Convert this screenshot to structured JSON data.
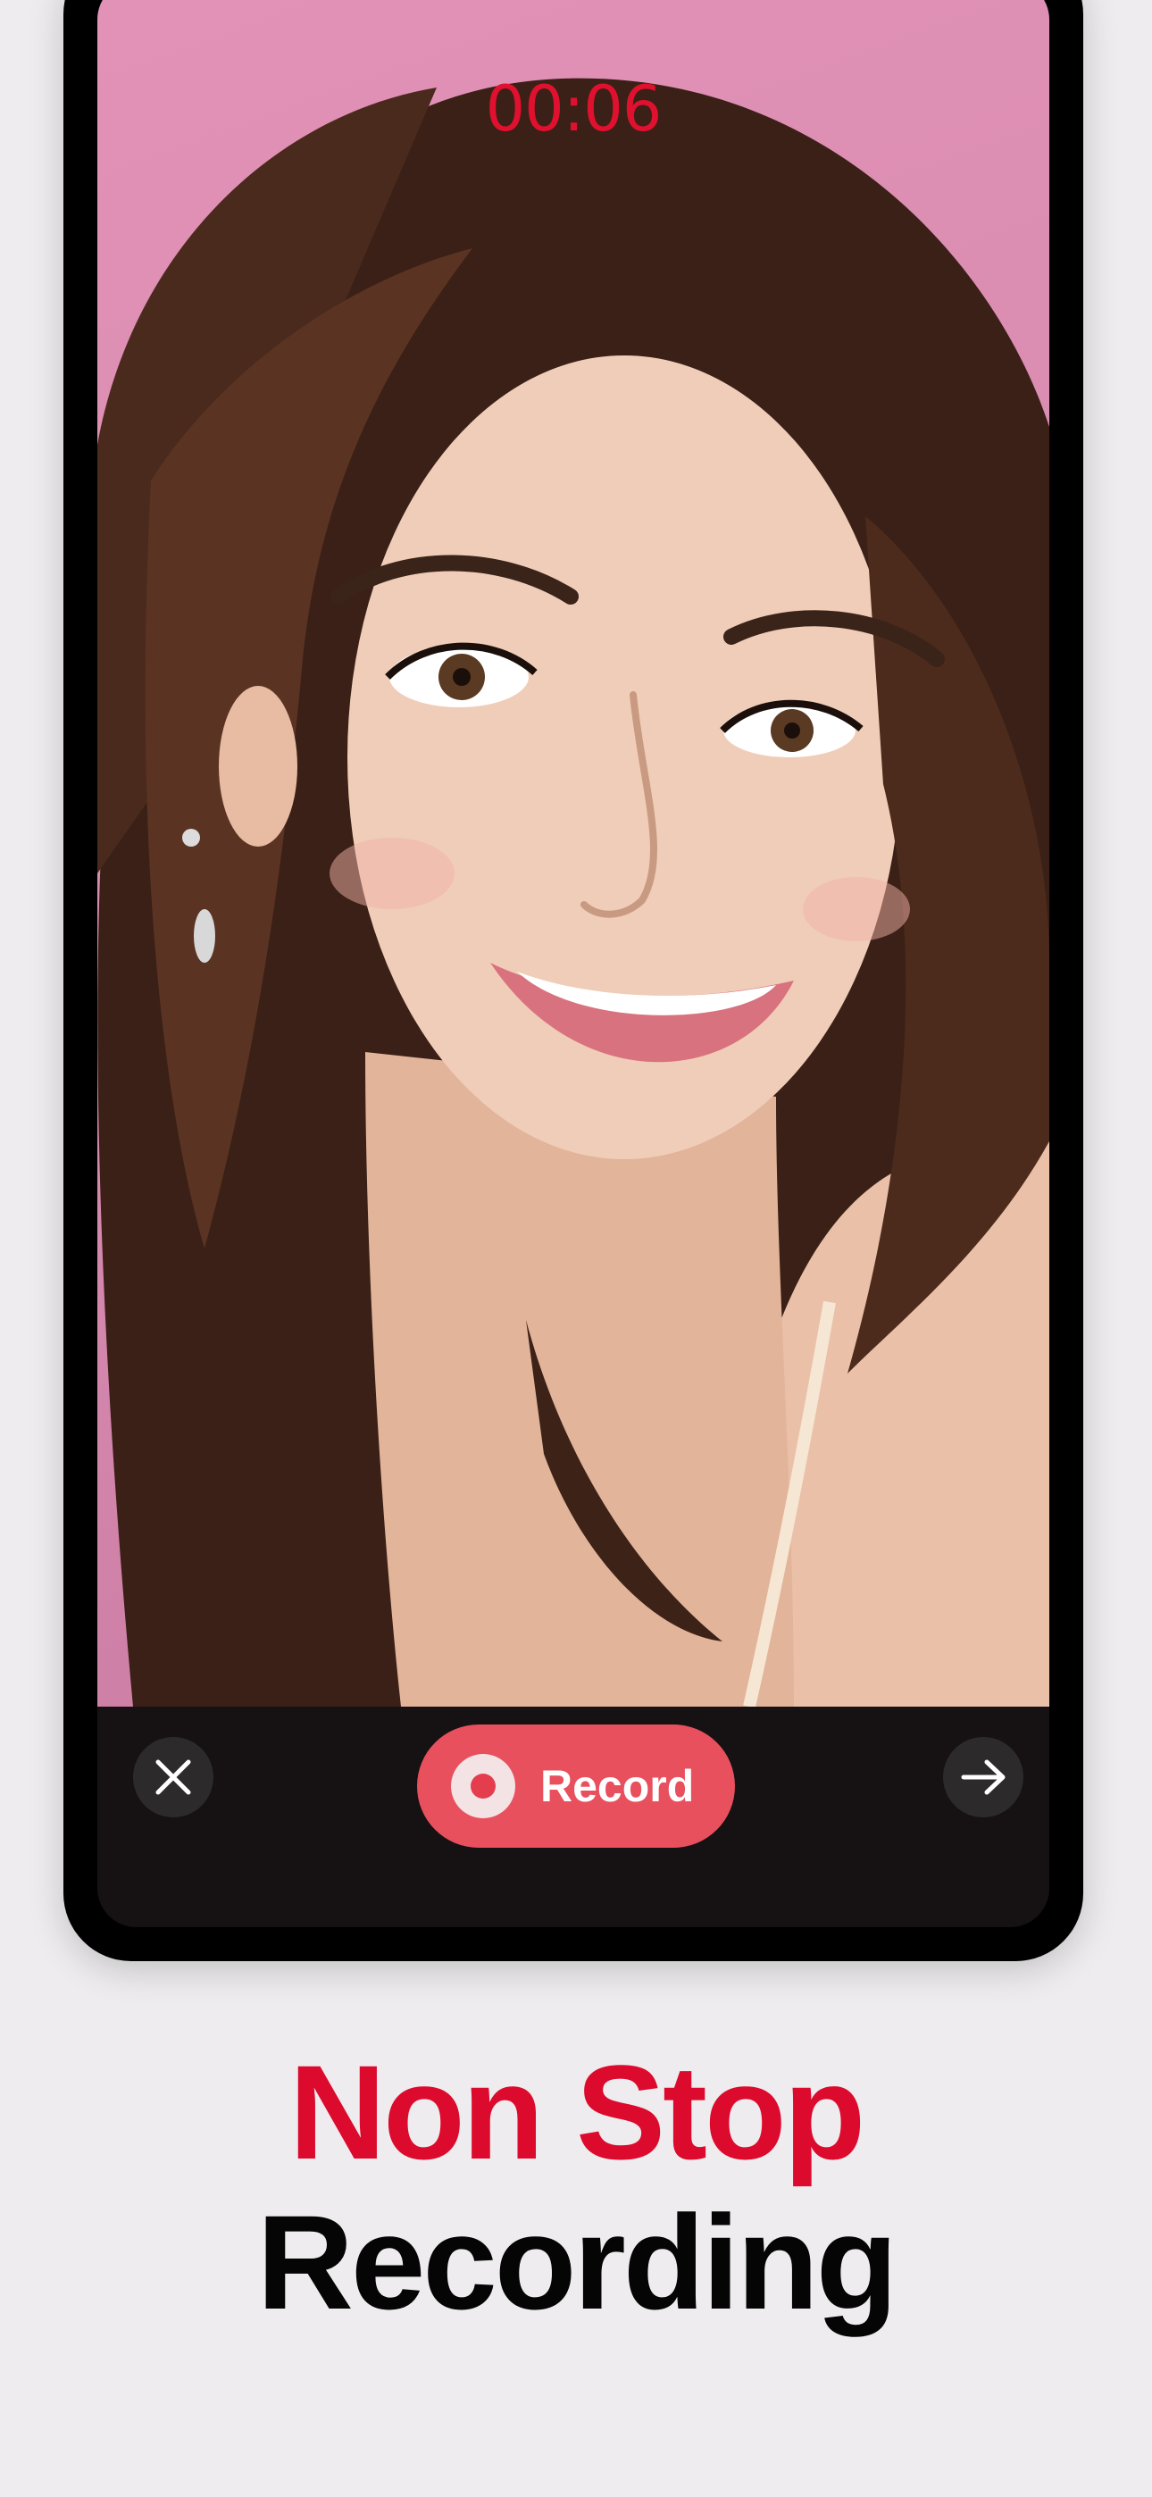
{
  "recorder": {
    "timer": "00:06",
    "record_label": "Record",
    "icons": {
      "close": "close-icon",
      "next": "arrow-right-icon",
      "record": "record-dot-icon"
    }
  },
  "headline": {
    "line1": "Non Stop",
    "line2": "Recording"
  },
  "colors": {
    "accent_red": "#dc0a2d",
    "record_button": "#e9505e",
    "timer": "#e0102f",
    "background": "#eeecee"
  }
}
